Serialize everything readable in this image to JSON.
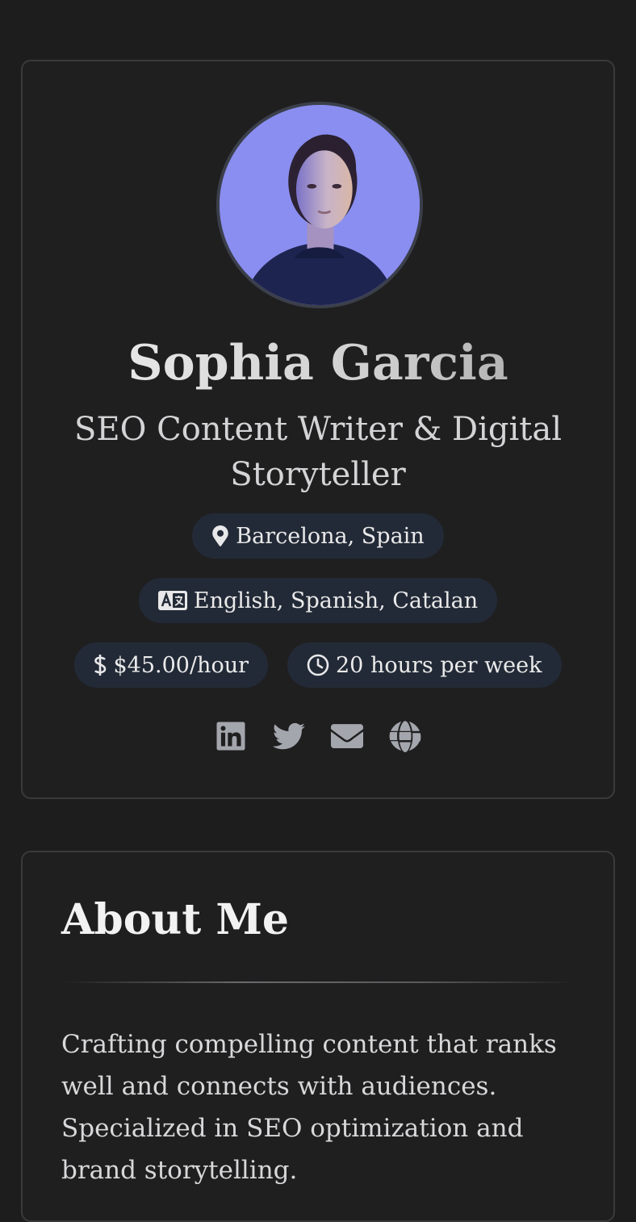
{
  "profile": {
    "name": "Sophia Garcia",
    "title": "SEO Content Writer & Digital Storyteller",
    "location": "Barcelona, Spain",
    "languages": "English, Spanish, Catalan",
    "rate": "$45.00/hour",
    "availability": "20 hours per week",
    "social": [
      {
        "icon": "linkedin-icon"
      },
      {
        "icon": "twitter-icon"
      },
      {
        "icon": "envelope-icon"
      },
      {
        "icon": "globe-icon"
      }
    ]
  },
  "about": {
    "heading": "About Me",
    "text": "Crafting compelling content that ranks well and connects with audiences. Specialized in SEO optimization and brand storytelling."
  },
  "colors": {
    "background": "#1d1d1e",
    "card": "#1f1f20",
    "pill": "#232a37",
    "icon": "#a4a6ad"
  }
}
